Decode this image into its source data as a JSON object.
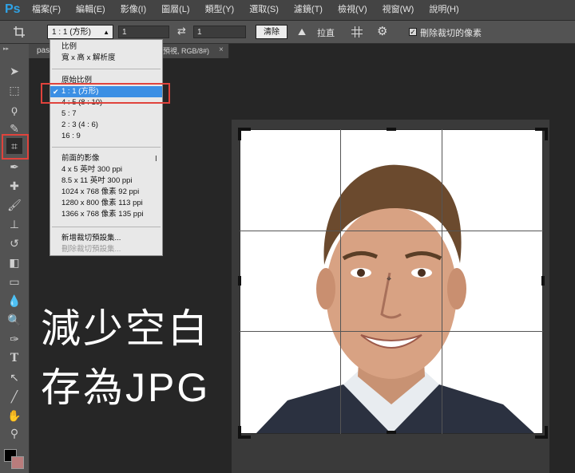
{
  "app": {
    "logo": "Ps"
  },
  "menu": {
    "items": [
      "檔案(F)",
      "編輯(E)",
      "影像(I)",
      "圖層(L)",
      "類型(Y)",
      "選取(S)",
      "濾鏡(T)",
      "檢視(V)",
      "視窗(W)",
      "說明(H)"
    ]
  },
  "options": {
    "ratio_value": "1 : 1 (方形)",
    "width_value": "1",
    "height_value": "1",
    "clear_label": "清除",
    "straighten_label": "拉直",
    "delete_pixels_label": "刪除裁切的像素",
    "delete_pixels_checked": true
  },
  "document": {
    "tab_prefix": "pas",
    "tab_suffix": "預視, RGB/8#)",
    "close_glyph": "×"
  },
  "dropdown": {
    "sections": [
      {
        "items": [
          {
            "label": "比例"
          },
          {
            "label": "寬 x 高 x 解析度"
          }
        ]
      },
      {
        "items": [
          {
            "label": "原始比例"
          },
          {
            "label": "1 : 1 (方形)",
            "selected": true,
            "checked": true
          },
          {
            "label": "4 : 5 (8 : 10)"
          },
          {
            "label": "5 : 7"
          },
          {
            "label": "2 : 3 (4 : 6)"
          },
          {
            "label": "16 : 9"
          }
        ]
      },
      {
        "items": [
          {
            "label": "前面的影像"
          },
          {
            "label": "4 x 5 英吋 300 ppi"
          },
          {
            "label": "8.5 x 11 英吋 300 ppi"
          },
          {
            "label": "1024 x 768 像素 92 ppi"
          },
          {
            "label": "1280 x 800 像素 113 ppi"
          },
          {
            "label": "1366 x 768 像素 135 ppi"
          }
        ]
      },
      {
        "items": [
          {
            "label": "新增裁切預設集..."
          },
          {
            "label": "刪除裁切預設集...",
            "disabled": true
          }
        ]
      }
    ]
  },
  "overlay": {
    "line1": "減少空白",
    "line2": "存為JPG"
  },
  "colors": {
    "highlight_red": "#e0433c",
    "menu_selected": "#3b8fe4",
    "background_swatch": "#b97c7c",
    "foreground_swatch": "#000000"
  }
}
